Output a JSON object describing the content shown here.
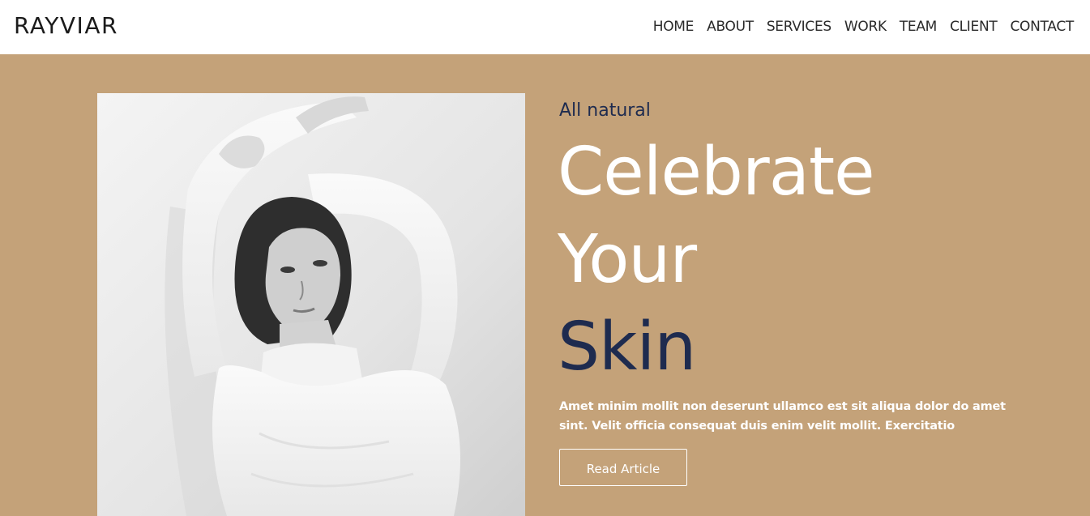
{
  "header": {
    "logo": "RAYVIAR",
    "nav": [
      "HOME",
      "ABOUT",
      "SERVICES",
      "WORK",
      "TEAM",
      "CLIENT",
      "CONTACT"
    ]
  },
  "hero": {
    "eyebrow": "All natural",
    "headline_line1": "Celebrate",
    "headline_line2": "Your",
    "headline_line3": "Skin",
    "body": "Amet minim mollit non deserunt ullamco est sit aliqua dolor do amet sint. Velit officia consequat duis enim velit mollit. Exercitatio",
    "cta_label": "Read Article",
    "image_subject": "woman-portrait-photo"
  },
  "colors": {
    "hero_background": "#c4a279",
    "accent_navy": "#1e2b4f",
    "header_background": "#ffffff",
    "text_white": "#ffffff"
  }
}
